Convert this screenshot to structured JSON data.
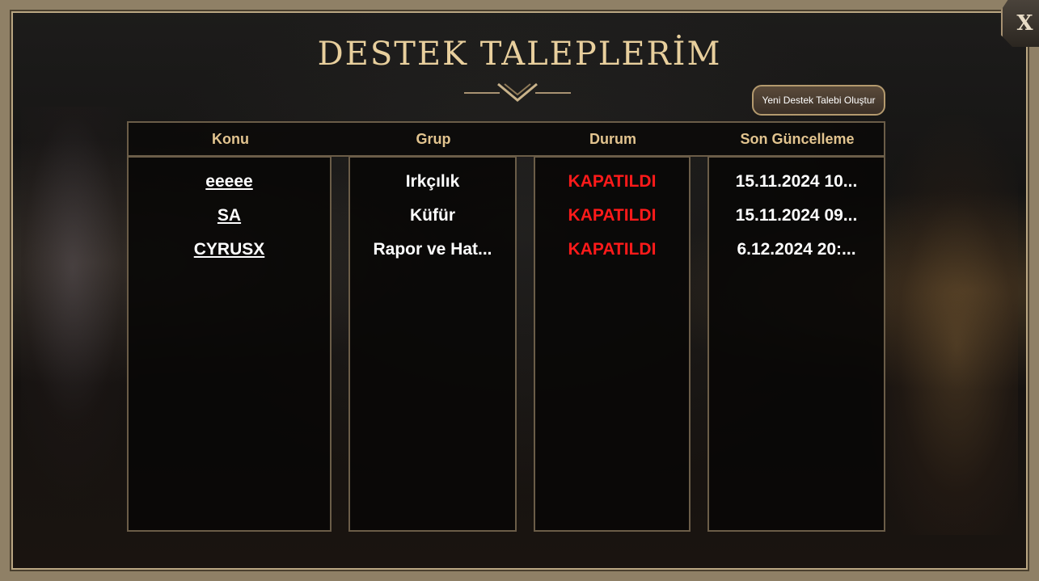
{
  "title": "DESTEK TALEPLERİM",
  "new_ticket_label": "Yeni Destek Talebi Oluştur",
  "close_label": "X",
  "columns": [
    "Konu",
    "Grup",
    "Durum",
    "Son Güncelleme"
  ],
  "rows": [
    {
      "konu": "eeeee",
      "grup": "Irkçılık",
      "durum": "KAPATILDI",
      "son_guncelleme": "15.11.2024 10..."
    },
    {
      "konu": "SA",
      "grup": "Küfür",
      "durum": "KAPATILDI",
      "son_guncelleme": "15.11.2024 09..."
    },
    {
      "konu": "CYRUSX",
      "grup": "Rapor ve Hat...",
      "durum": "KAPATILDI",
      "son_guncelleme": "6.12.2024 20:..."
    }
  ],
  "colors": {
    "header_text": "#e2c48f",
    "title_text": "#e8cf9d",
    "status_closed": "#ff1a1a",
    "border": "#6b5d48"
  }
}
